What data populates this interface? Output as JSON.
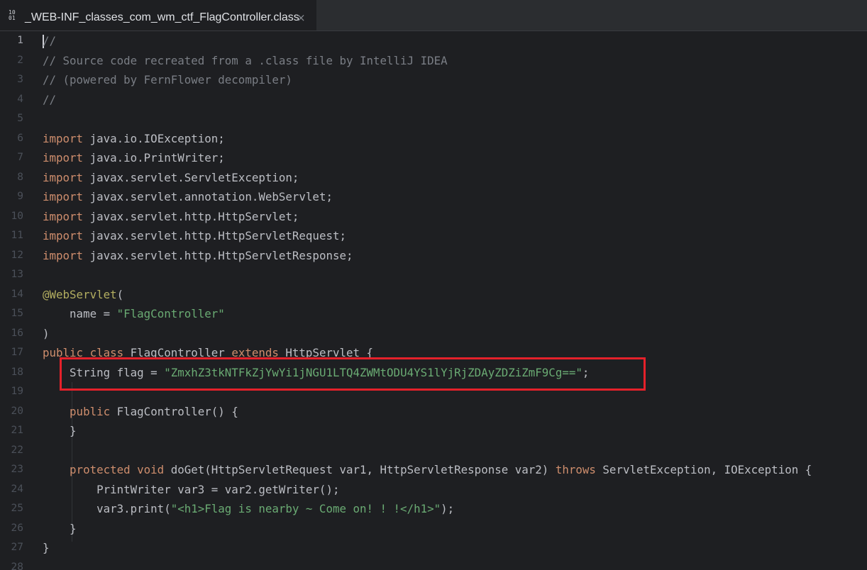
{
  "tab": {
    "icon_glyph_top": "10",
    "icon_glyph_bottom": "01",
    "label": "_WEB-INF_classes_com_wm_ctf_FlagController.class",
    "close_glyph": "×"
  },
  "gutter": {
    "current_line": 1,
    "line_numbers": [
      "1",
      "2",
      "3",
      "4",
      "5",
      "6",
      "7",
      "8",
      "9",
      "10",
      "11",
      "12",
      "13",
      "14",
      "15",
      "16",
      "17",
      "18",
      "19",
      "20",
      "21",
      "22",
      "23",
      "24",
      "25",
      "26",
      "27",
      "28"
    ]
  },
  "code": {
    "l1": "//",
    "l2": "// Source code recreated from a .class file by IntelliJ IDEA",
    "l3": "// (powered by FernFlower decompiler)",
    "l4": "//",
    "import_kw": "import",
    "l6": " java.io.IOException;",
    "l7": " java.io.PrintWriter;",
    "l8": " javax.servlet.ServletException;",
    "l9": " javax.servlet.annotation.WebServlet;",
    "l10": " javax.servlet.http.HttpServlet;",
    "l11": " javax.servlet.http.HttpServletRequest;",
    "l12": " javax.servlet.http.HttpServletResponse;",
    "l14_ann": "@WebServlet",
    "l14_rest": "(",
    "l15_a": "    name = ",
    "l15_str": "\"FlagController\"",
    "l16": ")",
    "l17_kw1": "public class",
    "l17_name": " FlagController ",
    "l17_kw2": "extends",
    "l17_rest": " HttpServlet {",
    "l18_a": "    String flag = ",
    "l18_str": "\"ZmxhZ3tkNTFkZjYwYi1jNGU1LTQ4ZWMtODU4YS1lYjRjZDAyZDZiZmF9Cg==\"",
    "l18_b": ";",
    "l20_indent": "    ",
    "l20_kw": "public",
    "l20_rest": " FlagController() {",
    "l21": "    }",
    "l23_indent": "    ",
    "l23_kw1": "protected void",
    "l23_mid": " doGet(HttpServletRequest var1, HttpServletResponse var2) ",
    "l23_kw2": "throws",
    "l23_rest": " ServletException, IOException {",
    "l24": "        PrintWriter var3 = var2.getWriter();",
    "l25_a": "        var3.print(",
    "l25_str": "\"<h1>Flag is nearby ~ Come on! ! !</h1>\"",
    "l25_b": ");",
    "l26": "    }",
    "l27": "}"
  },
  "colors": {
    "background": "#1e1f22",
    "keyword": "#cf8e6d",
    "comment": "#7a7e85",
    "string": "#6aab73",
    "annotation": "#b3ae60",
    "highlight_box": "#e5212a"
  }
}
